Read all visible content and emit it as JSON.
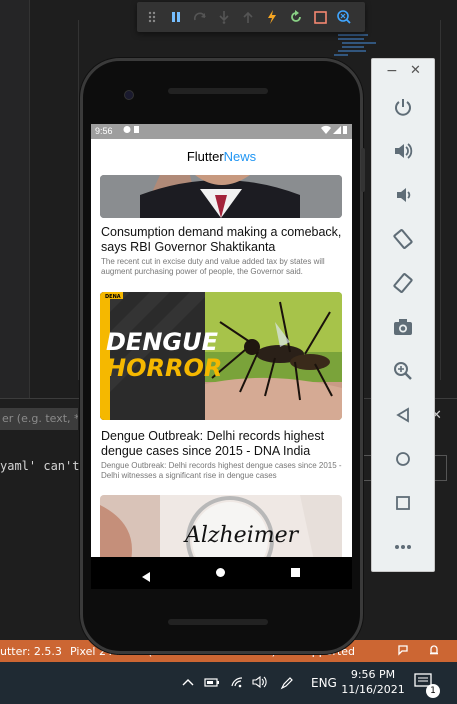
{
  "ide": {
    "filter_placeholder": "er (e.g. text, **/*",
    "error_text": "yaml' can't be",
    "error_box_text": "0]",
    "statusbar": {
      "flutter_version": "utter: 2.5.3",
      "device": "Pixel 2 API 30 (android-x86 emulator)",
      "unsupported": "Unsupported"
    },
    "debug_toolbar_icons": [
      "drag-handle-icon",
      "pause-icon",
      "step-over-icon",
      "step-into-icon",
      "step-out-icon",
      "hot-reload-icon",
      "hot-restart-icon",
      "stop-icon",
      "devtools-icon"
    ]
  },
  "taskbar": {
    "language": "ENG",
    "time": "9:56 PM",
    "date": "11/16/2021",
    "notification_count": "1"
  },
  "emulator_panel": {
    "buttons": [
      "power-icon",
      "volume-up-icon",
      "volume-down-icon",
      "rotate-left-icon",
      "rotate-right-icon",
      "screenshot-icon",
      "zoom-icon",
      "back-icon",
      "home-icon",
      "overview-icon",
      "more-icon"
    ]
  },
  "phone": {
    "status_time": "9:56",
    "app_title_1": "Flutter",
    "app_title_2": "News",
    "articles": [
      {
        "title": "Consumption demand making a comeback, says RBI Governor Shaktikanta",
        "description": "The recent cut in excise duty and value added tax by states will augment purchasing power of people, the Governor said."
      },
      {
        "title": "Dengue Outbreak: Delhi records highest dengue cases since 2015 - DNA India",
        "description": "Dengue Outbreak: Delhi records highest dengue cases since 2015 - Delhi witnesses a significant rise in dengue cases",
        "image_text_1": "DENGUE",
        "image_text_2": "HORROR",
        "image_badge": "DENA"
      },
      {
        "image_text": "Alzheimer"
      }
    ]
  },
  "colors": {
    "statusbar": "#cc6633",
    "accent_blue": "#2196f3",
    "dengue_yellow": "#f5b800"
  }
}
